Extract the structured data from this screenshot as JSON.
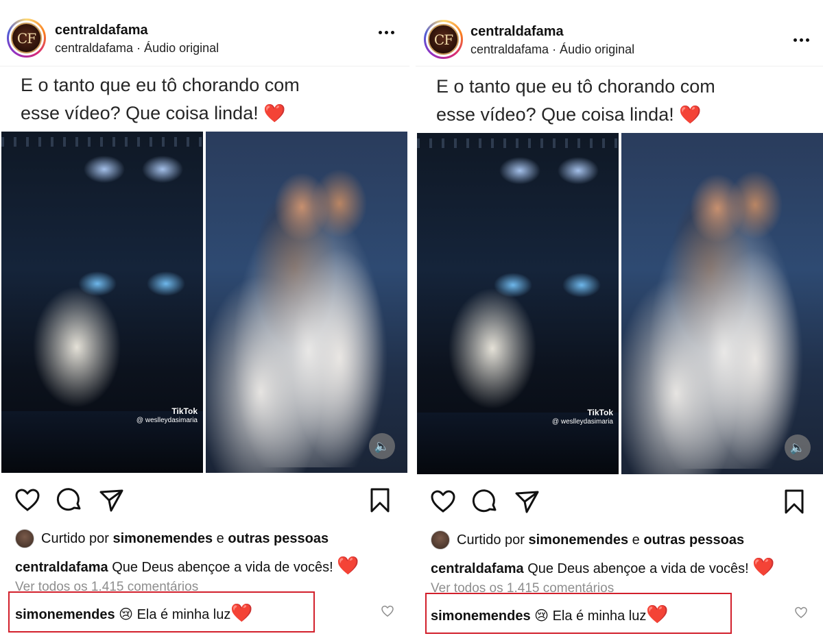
{
  "post": {
    "username": "centraldafama",
    "avatar_text": "CF",
    "subline": "centraldafama · Áudio original",
    "caption_line1": "E o tanto que eu tô chorando com",
    "caption_line2": "esse vídeo? Que coisa linda!",
    "heart_emoji": "❤️",
    "watermark_brand": "TikTok",
    "watermark_handle": "@ weslleydasimaria",
    "sound_icon": "speaker-icon",
    "liked_prefix": "Curtido por",
    "liked_user": "simonemendes",
    "liked_mid": "e",
    "liked_others": "outras pessoas",
    "caption_user": "centraldafama",
    "caption_text": "Que Deus abençoe a vida de vocês!",
    "view_all": "Ver todos os 1.415 comentários",
    "comment_user": "simonemendes",
    "comment_emoji": "😢",
    "comment_text": "Ela é minha luz",
    "comment_heart_emoji": "❤️",
    "highlight_color": "#d21f2b"
  }
}
